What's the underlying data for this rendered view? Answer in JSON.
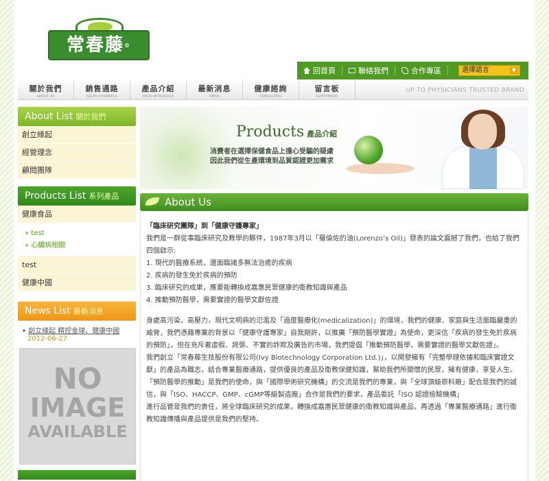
{
  "logo": {
    "text": "常春藤",
    "mark": "®"
  },
  "topbar": {
    "links": [
      {
        "label": "回首頁",
        "icon": "home-icon"
      },
      {
        "label": "聯絡我們",
        "icon": "mail-icon"
      },
      {
        "label": "合作專區",
        "icon": "handshake-icon"
      }
    ],
    "language_select": "選擇語言"
  },
  "nav": {
    "items": [
      {
        "zh": "關於我們",
        "en": "ABOUT US"
      },
      {
        "zh": "銷售通路",
        "en": "SALES CHANNELS"
      },
      {
        "zh": "產品介紹",
        "en": "PROD INTRODUCE"
      },
      {
        "zh": "最新消息",
        "en": "NEWS"
      },
      {
        "zh": "健康諮詢",
        "en": "CONSULTING"
      },
      {
        "zh": "留言板",
        "en": "GUESTBOOK"
      }
    ],
    "slogan": "UP TO PHYSICIANS TRUSTED BRAND"
  },
  "sidebar": {
    "about": {
      "title_en": "About List",
      "title_zh": "關於我們",
      "items": [
        "創立緣起",
        "經營理念",
        "顧問團隊"
      ]
    },
    "products": {
      "title_en": "Products List",
      "title_zh": "系列產品",
      "items": [
        "健康食品",
        "test",
        "健康中國"
      ],
      "subitems": [
        "» test",
        "» 心臟病相關"
      ]
    },
    "news": {
      "title_en": "News List",
      "title_zh": "最新消息",
      "item_title": "創立緣起 精控金球、健康中國",
      "item_date": "2012-06-27"
    },
    "no_image": {
      "line1": "NO",
      "line2": "IMAGE",
      "line3": "AVAILABLE"
    }
  },
  "banner": {
    "title_en": "Products",
    "title_zh": "產品介紹",
    "line1": "消費者在選擇保健食品上擔心受騙的疑慮",
    "line2": "因此我們從生產環境到品質認證更加需求"
  },
  "section": {
    "title": "About Us"
  },
  "content": {
    "heading": "「臨床研究團隊」到「健康守護專家」",
    "intro": "我們是一群從事臨床研究及教學的夥伴，1987年3月以「羅倫佐的油(Lorenzo’s Oil)」發表的論文震撼了我們，也給了我們四個啟示:",
    "points": [
      "1. 現代的醫療系統，還面臨諸多無法治癒的疾病",
      "2. 疾病的發生免於疾病的預防",
      "3. 臨床研究的成果，應要能轉換成嘉惠民眾健康的衛教知識與產品",
      "4. 推動預防醫學，需要實證的醫學文獻佐證"
    ],
    "para1": "身處高污染，高壓力，現代文明病的氾濫及「過度醫療化(medicalization)」的環境，我們的健康、家庭與生活面臨嚴重的威脅，我們憑藉專業的背景以「健康守護專家」自我期許，以推廣「預防醫學實證」為使命，更深信「疾病的發生免於疾病的預防」，但在充斥著虛假、誇張、不實的詐欺及廣告的市場，我們提倡「推動預防醫學，需要實證的醫學文獻佐證」。",
    "para2": "我們創立「常春藤生技股份有限公司(Ivy Biotechnology Corporation Ltd.)」，以開發擁有「完整學理依據和臨床實證文獻」的產品為職志，結合專業醫療通路，提供優良的產品及衛教保健知識，幫助我們所關懷的民眾，擁有健康，享受人生。",
    "para3": "「預防醫學的推動」是我們的使命，與「國際學術研究機構」的交流是我們的專業，與「全球頂級原料廠」配合是我們的誠信，與「ISO、HACCP、GMP、cGMP等級製造廠」合作是我們的要求，產品委託「ISO 認證檢驗機構」",
    "para4": "進行品管是我們的責任，將全球臨床研究的成果，轉換成嘉惠民眾健康的衛教知識與產品，再透過「專業醫療通路」進行衛教知識傳播與產品提供是我們的堅持。"
  }
}
